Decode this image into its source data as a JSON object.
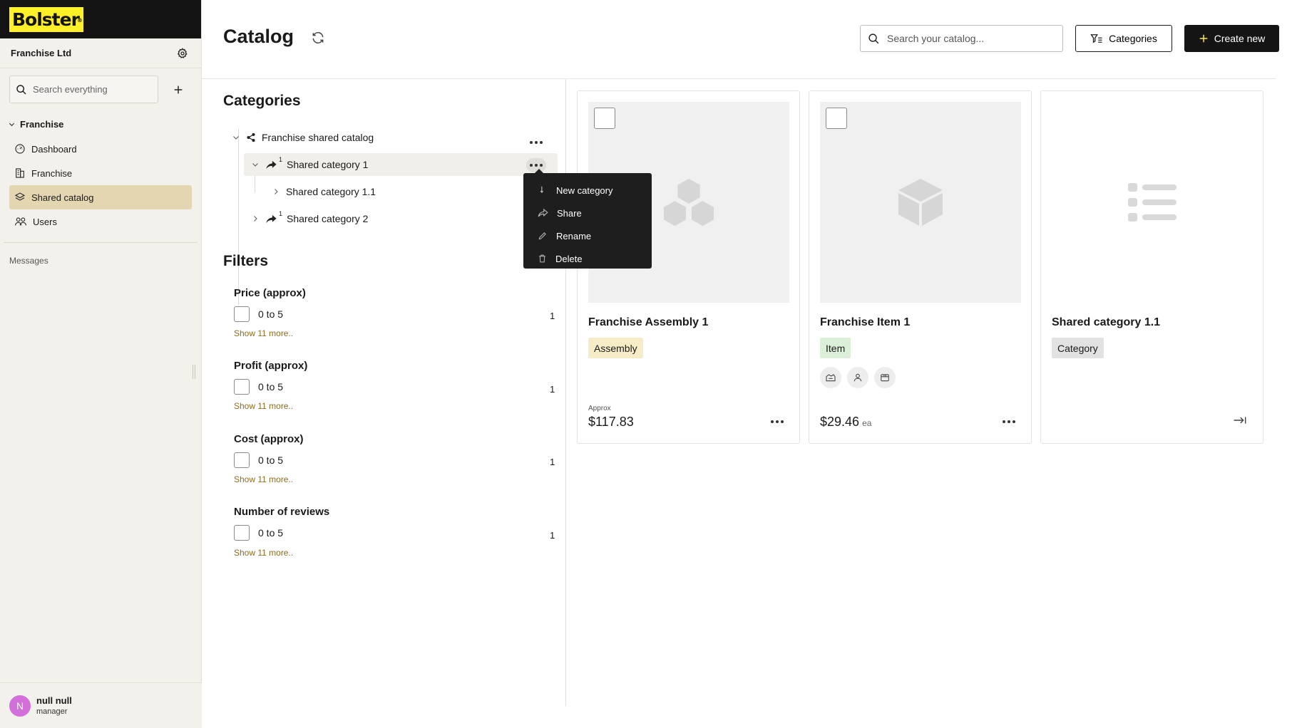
{
  "brand": {
    "logo_text": "Bolster",
    "logo_mark": "®",
    "accent": "#fff02a"
  },
  "sidebar": {
    "org_name": "Franchise Ltd",
    "search_placeholder": "Search everything",
    "section_title": "Franchise",
    "items": [
      {
        "label": "Dashboard",
        "icon": "dashboard-icon"
      },
      {
        "label": "Franchise",
        "icon": "building-icon"
      },
      {
        "label": "Shared catalog",
        "icon": "catalog-icon",
        "active": true
      },
      {
        "label": "Users",
        "icon": "users-icon"
      }
    ],
    "messages_label": "Messages",
    "user": {
      "initial": "N",
      "name": "null null",
      "role": "manager"
    }
  },
  "header": {
    "title": "Catalog",
    "search_placeholder": "Search your catalog...",
    "categories_label": "Categories",
    "create_label": "Create new"
  },
  "categories": {
    "heading": "Categories",
    "tree": [
      {
        "label": "Franchise shared catalog",
        "level": 0
      },
      {
        "label": "Shared category 1",
        "level": 1,
        "shared_count": "1"
      },
      {
        "label": "Shared category 1.1",
        "level": 2
      },
      {
        "label": "Shared category 2",
        "level": 1,
        "shared_count": "1"
      }
    ]
  },
  "context_menu": {
    "items": [
      {
        "label": "New category",
        "icon": "arrow-down-icon"
      },
      {
        "label": "Share",
        "icon": "share-icon"
      },
      {
        "label": "Rename",
        "icon": "pencil-icon"
      },
      {
        "label": "Delete",
        "icon": "trash-icon"
      }
    ]
  },
  "filters": {
    "heading": "Filters",
    "groups": [
      {
        "title": "Price (approx)",
        "option": "0 to 5",
        "count": "1",
        "more": "Show 11 more.."
      },
      {
        "title": "Profit (approx)",
        "option": "0 to 5",
        "count": "1",
        "more": "Show 11 more.."
      },
      {
        "title": "Cost (approx)",
        "option": "0 to 5",
        "count": "1",
        "more": "Show 11 more.."
      },
      {
        "title": "Number of reviews",
        "option": "0 to 5",
        "count": "1",
        "more": "Show 11 more.."
      }
    ]
  },
  "cards": [
    {
      "title": "Franchise Assembly 1",
      "badge": "Assembly",
      "approx_label": "Approx",
      "price": "$117.83"
    },
    {
      "title": "Franchise Item 1",
      "badge": "Item",
      "price": "$29.46",
      "unit": "ea"
    },
    {
      "title": "Shared category 1.1",
      "badge": "Category"
    }
  ]
}
